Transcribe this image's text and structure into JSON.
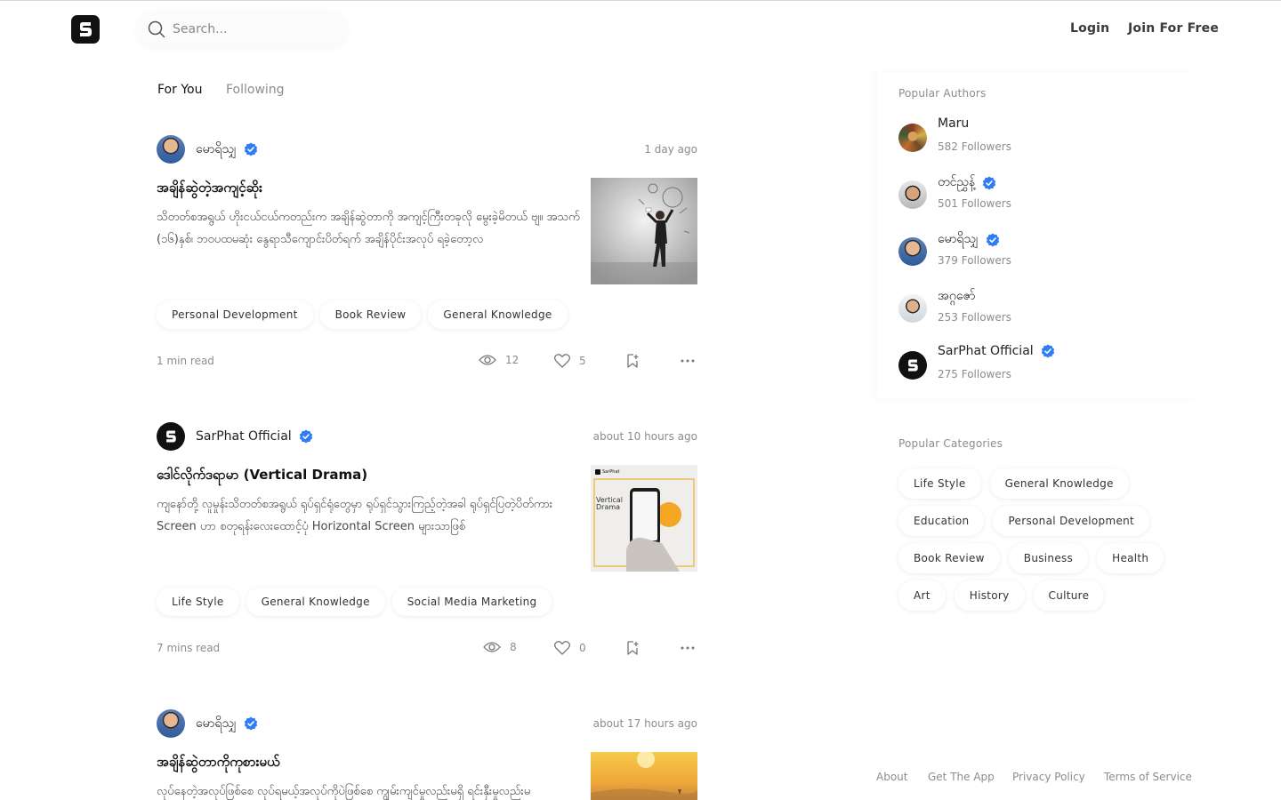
{
  "header": {
    "search_placeholder": "Search...",
    "login_label": "Login",
    "join_label": "Join For Free"
  },
  "tabs": [
    {
      "label": "For You",
      "active": true
    },
    {
      "label": "Following",
      "active": false
    }
  ],
  "posts": [
    {
      "author": "မောရိသျှ",
      "verified": true,
      "time": "1 day ago",
      "title": "အချိန်ဆွဲတဲ့အကျင့်ဆိုး",
      "excerpt": "သိတတ်စအရွယ် ဟိုးငယ်ငယ်ကတည်းက အချိန်ဆွဲတာကို အကျင့်ကြီးတခုလို မွေးခဲ့မိတယ် ဗျ။ အသက် (၁၆)နှစ်၊ ဘဝပထမဆုံး နွေရာသီကျောင်းပိတ်ရက် အချိန်ပိုင်းအလုပ် ရခဲ့တော့လ",
      "tags": [
        "Personal Development",
        "Book Review",
        "General Knowledge"
      ],
      "read_time": "1 min read",
      "views": "12",
      "likes": "5"
    },
    {
      "author": "SarPhat Official",
      "verified": true,
      "time": "about 10 hours ago",
      "title": "ဒေါင်လိုက်ဒရာမာ (Vertical Drama)",
      "excerpt": "ကျနော်တို့ လူမှုန်းသိတတ်စအရွယ် ရုပ်ရှင်ရုံတွေမှာ ရုပ်ရှင်သွားကြည့်တဲ့အခါ ရုပ်ရှင်ပြတဲ့ပိတ်ကား Screen ဟာ စတုရန်းလေးထောင့်ပုံ Horizontal Screen များသာဖြစ်",
      "tags": [
        "Life Style",
        "General Knowledge",
        "Social Media Marketing"
      ],
      "read_time": "7 mins read",
      "views": "8",
      "likes": "0",
      "thumb_text": "Vertical Drama",
      "thumb_brand": "SarPhat"
    },
    {
      "author": "မောရိသျှ",
      "verified": true,
      "time": "about 17 hours ago",
      "title": "အချိန်ဆွဲတာကိုကုစားမယ်",
      "excerpt": "လုပ်နေတဲ့အလုပ်ဖြစ်စေ လုပ်ရမယ့်အလုပ်ကိုပဲဖြစ်စေ ကျွမ်းကျင်မှုလည်းမရှိ ရင်းနှီးမှုလည်းမ"
    }
  ],
  "sidebar": {
    "popular_authors_title": "Popular Authors",
    "authors": [
      {
        "name": "Maru",
        "followers": "582 Followers",
        "verified": false
      },
      {
        "name": "တင်ညွှန့်",
        "followers": "501 Followers",
        "verified": true
      },
      {
        "name": "မောရိသျှ",
        "followers": "379 Followers",
        "verified": true
      },
      {
        "name": "အဂ္ဂဇော်",
        "followers": "253 Followers",
        "verified": false
      },
      {
        "name": "SarPhat Official",
        "followers": "275 Followers",
        "verified": true
      }
    ],
    "popular_categories_title": "Popular Categories",
    "categories": [
      [
        "Life Style",
        "General Knowledge"
      ],
      [
        "Education",
        "Personal Development"
      ],
      [
        "Book Review",
        "Business",
        "Health"
      ],
      [
        "Art",
        "History",
        "Culture"
      ]
    ]
  },
  "footer": {
    "links": [
      "About",
      "Get The App",
      "Privacy Policy",
      "Terms of Service"
    ]
  },
  "colors": {
    "verified": "#2e7cf6",
    "muted_text": "#8c8c8c",
    "logo_bg": "#111111"
  }
}
